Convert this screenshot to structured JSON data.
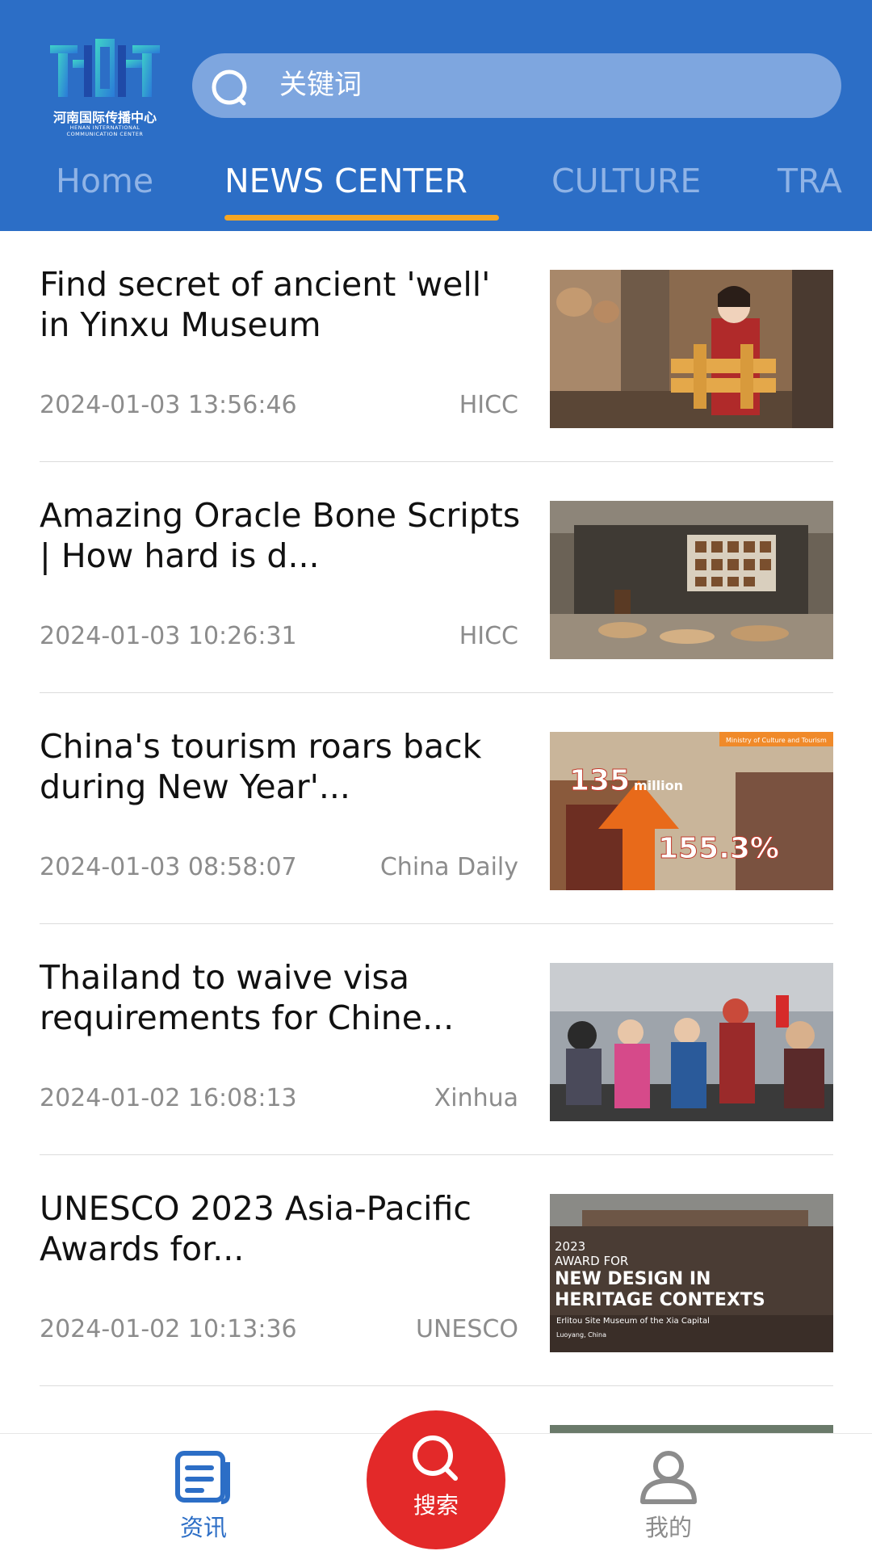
{
  "header": {
    "logo": {
      "name_cn": "河南国际传播中心",
      "name_en_line1": "HENAN INTERNATIONAL",
      "name_en_line2": "COMMUNICATION CENTER"
    },
    "search": {
      "placeholder": "关键词",
      "icon": "search-icon"
    },
    "tabs": [
      {
        "label": "Home",
        "active": false
      },
      {
        "label": "NEWS CENTER",
        "active": true
      },
      {
        "label": "CULTURE",
        "active": false
      },
      {
        "label": "TRA",
        "active": false
      }
    ],
    "colors": {
      "background": "#2c6ec6",
      "active_underline": "#f5a623"
    }
  },
  "news": [
    {
      "title": "Find secret of ancient 'well' in Yinxu Museum",
      "time": "2024-01-03 13:56:46",
      "source": "HICC"
    },
    {
      "title": "Amazing Oracle Bone Scripts | How hard is d...",
      "time": "2024-01-03 10:26:31",
      "source": "HICC"
    },
    {
      "title": "China's tourism roars back during New Year'...",
      "time": "2024-01-03 08:58:07",
      "source": "China Daily",
      "thumb_text": {
        "ministry": "Ministry of Culture and Tourism",
        "big_number": "135",
        "unit": "million",
        "percent": "155.3%"
      }
    },
    {
      "title": "Thailand to waive visa requirements for Chine...",
      "time": "2024-01-02 16:08:13",
      "source": "Xinhua"
    },
    {
      "title": "UNESCO 2023 Asia-Pacific Awards for...",
      "time": "2024-01-02 10:13:36",
      "source": "UNESCO",
      "thumb_text": {
        "year": "2023",
        "award": "AWARD FOR",
        "line1": "NEW DESIGN IN",
        "line2": "HERITAGE CONTEXTS",
        "museum": "Erlitou Site Museum of the Xia Capital",
        "location": "Luoyang, China"
      }
    },
    {
      "title": "",
      "time": "",
      "source": ""
    }
  ],
  "bottom_nav": {
    "news_label": "资讯",
    "search_label": "搜索",
    "mine_label": "我的",
    "colors": {
      "active": "#2c6ec6",
      "inactive": "#8c8c8c",
      "search_button": "#e32929"
    }
  }
}
